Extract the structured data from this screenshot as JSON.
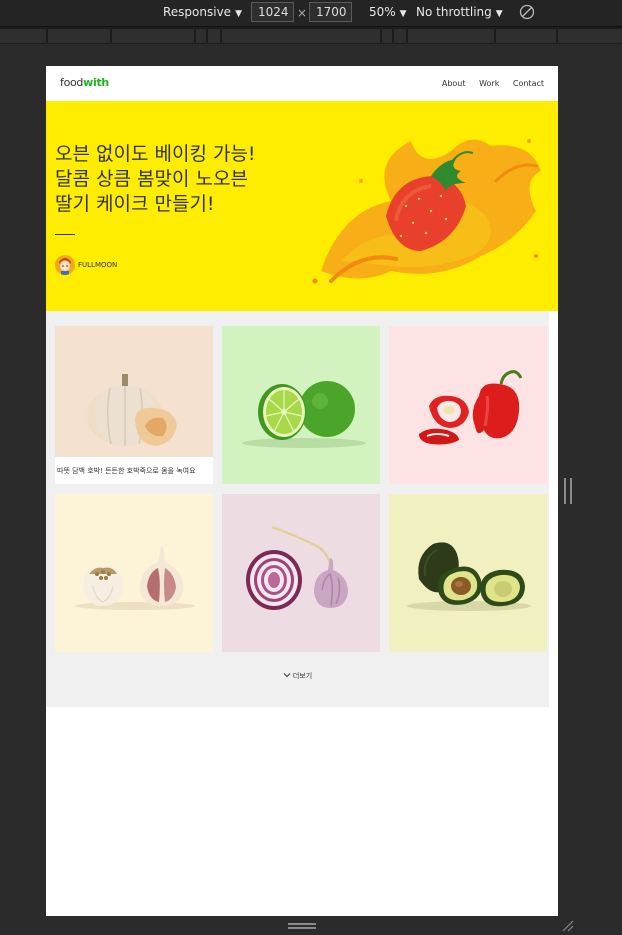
{
  "devtools": {
    "device_mode": "Responsive",
    "width": "1024",
    "height": "1700",
    "zoom": "50%",
    "throttling": "No throttling"
  },
  "site": {
    "logo_food": "food",
    "logo_with": "with",
    "nav": [
      "About",
      "Work",
      "Contact"
    ],
    "hero": {
      "title": "오븐 없이도 베이킹 가능!\n달콤 상큼 봄맞이 노오븐\n딸기 케이크 만들기!",
      "author": "FULLMOON"
    },
    "cards": [
      {
        "icon": "pumpkin",
        "caption": "따뜻 담백 호박! 든든한 호박죽으로 몸을 녹여요"
      },
      {
        "icon": "lime"
      },
      {
        "icon": "red-pepper"
      },
      {
        "icon": "garlic"
      },
      {
        "icon": "red-onion"
      },
      {
        "icon": "avocado"
      }
    ],
    "more_label": "더보기"
  },
  "colors": {
    "hero_bg": "#ffed00",
    "logo_accent": "#1db31d",
    "card_pumpkin": "#f4e1cf",
    "card_lime": "#d2f2bf",
    "card_pepper": "#fde3e3",
    "card_garlic": "#fdf3d7",
    "card_onion": "#eddde2",
    "card_avocado": "#f0f0c0"
  }
}
